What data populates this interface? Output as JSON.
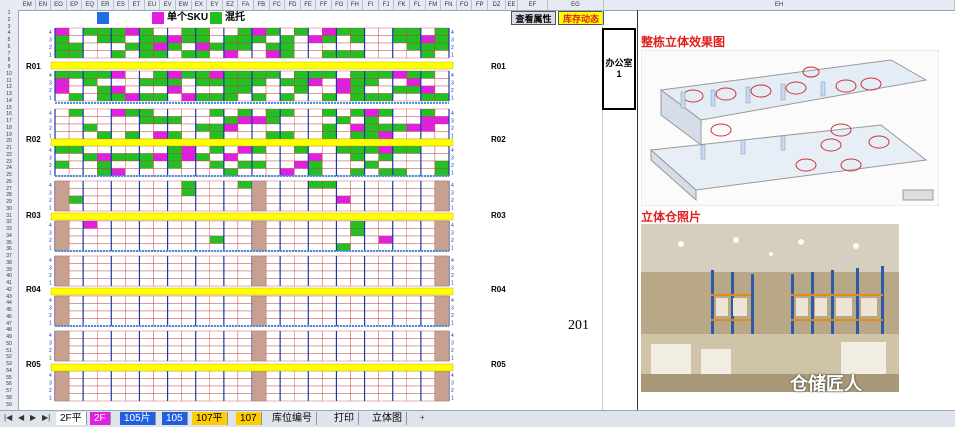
{
  "column_headers": [
    "EM",
    "EN",
    "EO",
    "EP",
    "EQ",
    "ER",
    "ES",
    "ET",
    "EU",
    "EV",
    "EW",
    "EX",
    "EY",
    "EZ",
    "FA",
    "FB",
    "FC",
    "FD",
    "FE",
    "FF",
    "FG",
    "FH",
    "FI",
    "FJ",
    "FK",
    "FL",
    "FM",
    "FN",
    "FO",
    "FP",
    "DZ",
    "EE",
    "EF",
    "EG",
    "EH"
  ],
  "legend": {
    "single_sku": "单个SKU",
    "mixed_pallet": "混托",
    "colors": {
      "blue": "#1f6fe0",
      "magenta": "#e020e0",
      "green": "#20c020"
    }
  },
  "buttons": {
    "view_attributes": "查看属性",
    "inventory_status": "库存动态"
  },
  "rows": [
    "R01",
    "R02",
    "R03",
    "R04",
    "R05"
  ],
  "office_label": "办公室1",
  "room_number": "201",
  "right_panel": {
    "effect_title": "整栋立体效果图",
    "photo_title": "立体仓照片",
    "watermark": "仓储匠人"
  },
  "sheet_tabs": [
    "2F平",
    "2F",
    "105片",
    "105",
    "107平",
    "107",
    "库位编号",
    "打印",
    "立体图"
  ],
  "active_tab_index": 1
}
